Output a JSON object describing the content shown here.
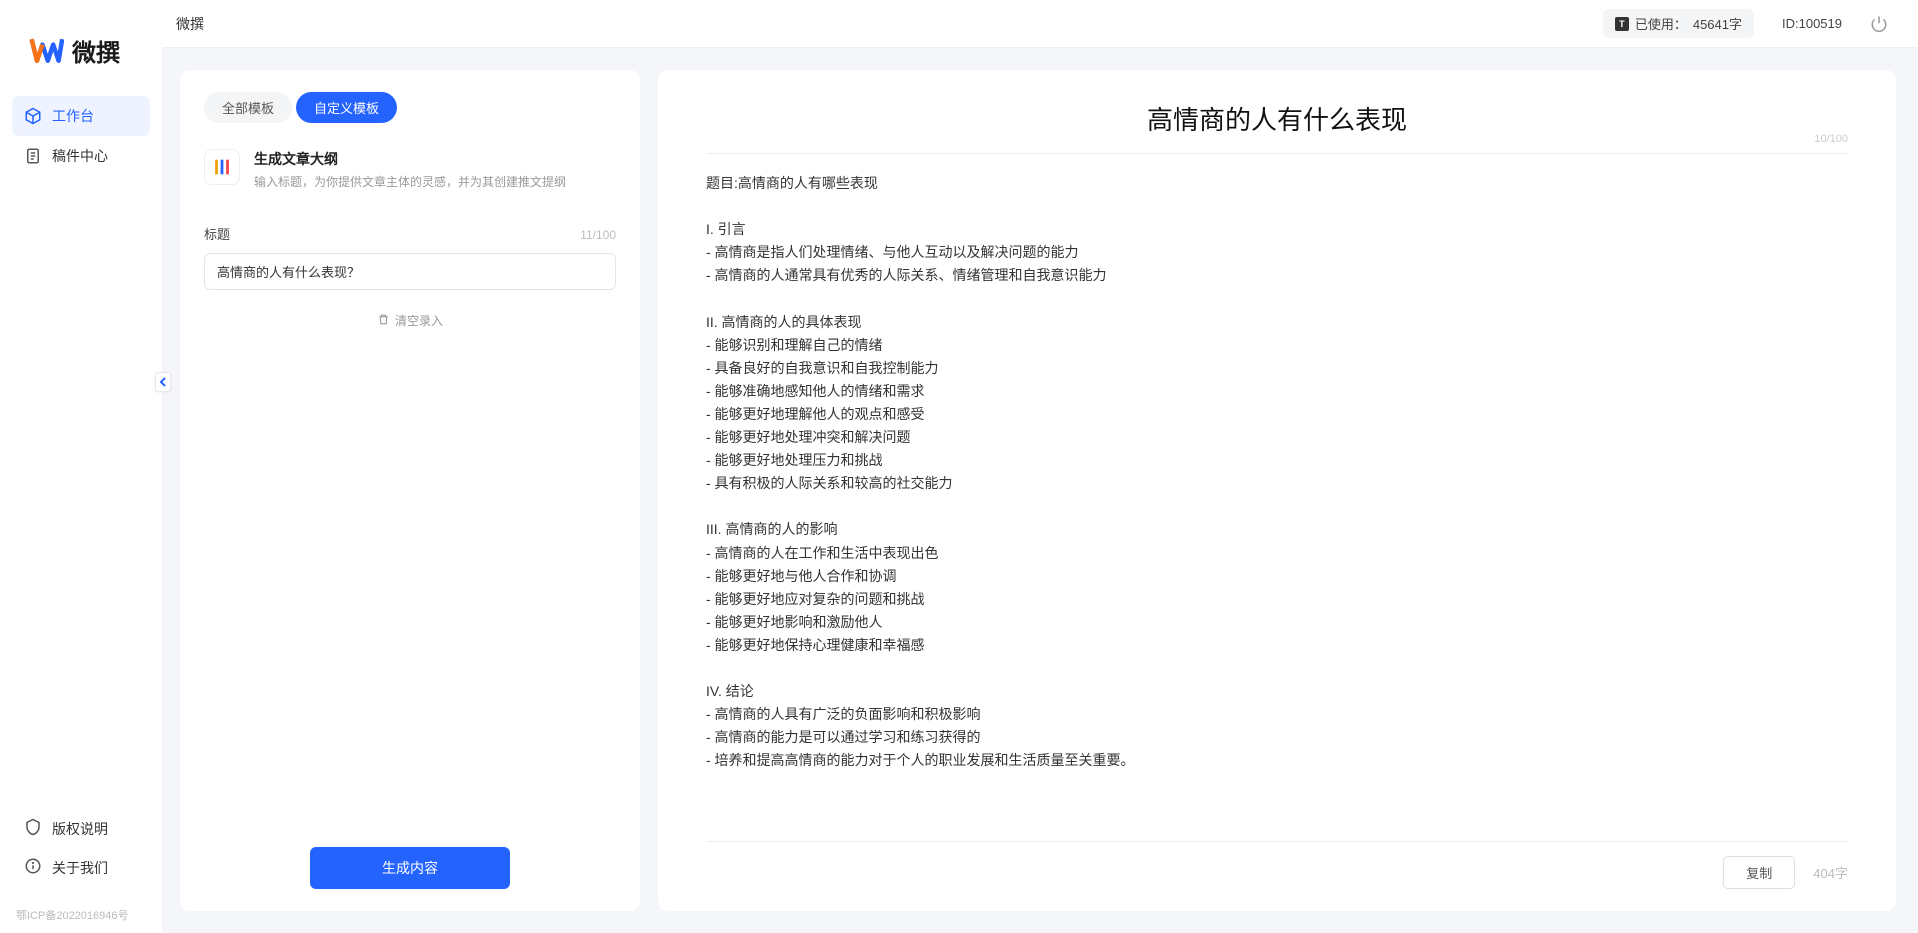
{
  "app": {
    "name": "微撰"
  },
  "sidebar": {
    "nav": [
      {
        "label": "工作台",
        "icon": "cube"
      },
      {
        "label": "稿件中心",
        "icon": "doc"
      }
    ],
    "bottom": [
      {
        "label": "版权说明",
        "icon": "shield"
      },
      {
        "label": "关于我们",
        "icon": "info"
      }
    ],
    "icp": "鄂ICP备2022016946号"
  },
  "topbar": {
    "title": "微撰",
    "usage_label": "已使用：",
    "usage_value": "45641字",
    "id_label": "ID:100519"
  },
  "left_panel": {
    "tabs": [
      "全部模板",
      "自定义模板"
    ],
    "active_tab": 1,
    "template": {
      "title": "生成文章大纲",
      "desc": "输入标题，为你提供文章主体的灵感，并为其创建推文提纲"
    },
    "field_label": "标题",
    "counter": "11/100",
    "input_value": "高情商的人有什么表现？",
    "clear_label": "清空录入",
    "generate_label": "生成内容"
  },
  "output": {
    "title": "高情商的人有什么表现",
    "title_counter": "10/100",
    "body": "题目:高情商的人有哪些表现\n\nI. 引言\n- 高情商是指人们处理情绪、与他人互动以及解决问题的能力\n- 高情商的人通常具有优秀的人际关系、情绪管理和自我意识能力\n\nII. 高情商的人的具体表现\n- 能够识别和理解自己的情绪\n- 具备良好的自我意识和自我控制能力\n- 能够准确地感知他人的情绪和需求\n- 能够更好地理解他人的观点和感受\n- 能够更好地处理冲突和解决问题\n- 能够更好地处理压力和挑战\n- 具有积极的人际关系和较高的社交能力\n\nIII. 高情商的人的影响\n- 高情商的人在工作和生活中表现出色\n- 能够更好地与他人合作和协调\n- 能够更好地应对复杂的问题和挑战\n- 能够更好地影响和激励他人\n- 能够更好地保持心理健康和幸福感\n\nIV. 结论\n- 高情商的人具有广泛的负面影响和积极影响\n- 高情商的能力是可以通过学习和练习获得的\n- 培养和提高高情商的能力对于个人的职业发展和生活质量至关重要。",
    "copy_label": "复制",
    "word_count": "404字"
  }
}
